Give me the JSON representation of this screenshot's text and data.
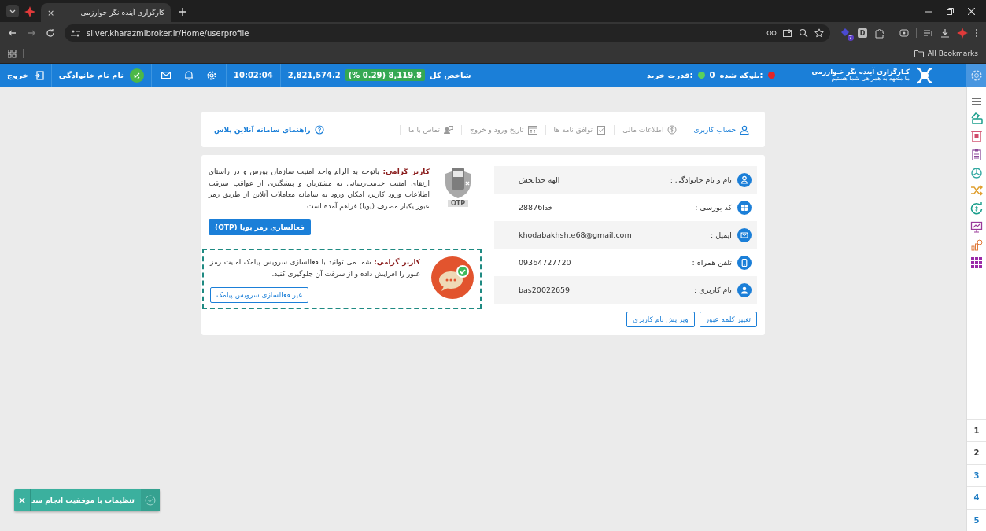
{
  "browser": {
    "tab_title": "کارگزاری آینده نگر خوارزمی",
    "tab_close": "×",
    "url": "silver.kharazmibroker.ir/Home/userprofile",
    "extension_badge": "7",
    "extension_letter": "D",
    "bookmarks_label": "All Bookmarks"
  },
  "app_bar": {
    "logout": "خروج",
    "user_name": "نام نام خانوادگی",
    "time": "10:02:04",
    "index_value": "2,821,574.2",
    "index_change": "(% 0.29) 8,119.8",
    "index_label": "شاخص کل",
    "buying_power_label": "قدرت خرید:",
    "blocked_value": "0",
    "blocked_label": "بلوکه شده:",
    "logo_title": "کـارگزاری آینده نگر خـوارزمی",
    "logo_subtitle": "ما متعهد به همراهی شما هستیم"
  },
  "profile_tabs": [
    {
      "label": "حساب کاربری",
      "kind": "user",
      "selected": true
    },
    {
      "label": "اطلاعات مالی",
      "kind": "money",
      "selected": false
    },
    {
      "label": "توافق نامه ها",
      "kind": "agreement",
      "selected": false
    },
    {
      "label": "تاریخ ورود و خروج",
      "kind": "calendar",
      "selected": false
    },
    {
      "label": "تماس با ما",
      "kind": "contact",
      "selected": false
    }
  ],
  "guide_link": "راهنمای سامانه آنلاین پلاس",
  "fields": [
    {
      "kind": "user",
      "label": "نام و نام خانوادگی :",
      "value": "الهه خدابخش"
    },
    {
      "kind": "code",
      "label": "کد بورسی :",
      "value": "خدا28876"
    },
    {
      "kind": "mail",
      "label": "ایمیل :",
      "value": "khodabakhsh.e68@gmail.com"
    },
    {
      "kind": "phone",
      "label": "تلفن همراه :",
      "value": "09364727720"
    },
    {
      "kind": "account",
      "label": "نام کاربری :",
      "value": "bas20022659"
    }
  ],
  "profile_buttons": [
    "تغییر کلمه عبور",
    "ویرایش نام کاربری"
  ],
  "otp_notice": {
    "text": "**کاربر گرامی:** باتوجه به الزام واحد امنیت سازمان بورس و در راستای ارتقای امنیت خدمت‌رسانی به مشتریان و پیشگیری از عواقب سرقت اطلاعات ورود کاربر، امکان ورود به سامانه معاملات آنلاین از طریق رمز عبور یکبار مصرف (پویا) فراهم آمده است.",
    "badge": "OTP",
    "button": "فعالسازی رمز پویا (OTP)"
  },
  "sms_notice": {
    "text": "**کاربر گرامی:** شما می توانید با فعالسازی سرویس پیامک امنیت رمز عبور را افزایش داده و از سرقت آن جلوگیری کنید.",
    "button": "غیر فعالسازی سرویس پیامک"
  },
  "side_pages": [
    {
      "label": "1",
      "color": "#333333"
    },
    {
      "label": "2",
      "color": "#333333"
    },
    {
      "label": "3",
      "color": "#1f7dc4"
    },
    {
      "label": "4",
      "color": "#1f7dc4"
    },
    {
      "label": "5",
      "color": "#1f7dc4"
    }
  ],
  "toast": {
    "message": "تنظیمات با موفقیت انجام شد",
    "close": "×"
  }
}
